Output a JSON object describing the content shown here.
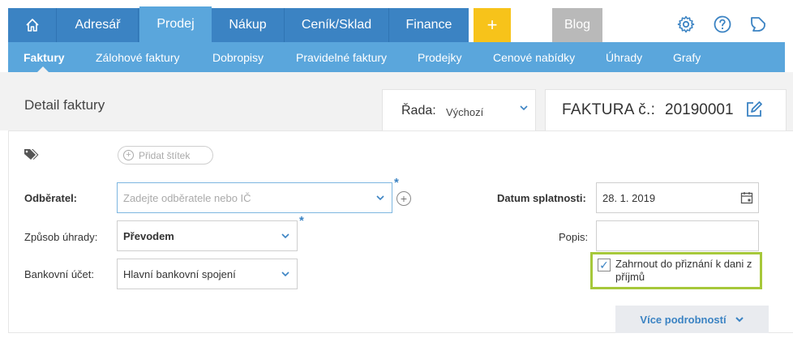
{
  "topnav": {
    "home_icon": "home-icon",
    "items": [
      {
        "label": "Adresář"
      },
      {
        "label": "Prodej",
        "active": true
      },
      {
        "label": "Nákup"
      },
      {
        "label": "Ceník/Sklad"
      },
      {
        "label": "Finance"
      }
    ],
    "plus_label": "+",
    "blog_label": "Blog",
    "icons": [
      "gear-icon",
      "help-icon",
      "feedback-icon"
    ],
    "colors": {
      "bar": "#3b83c3",
      "active": "#5aa6dc",
      "plus": "#f7c31a",
      "blog": "#b9b9b9"
    }
  },
  "subnav": {
    "items": [
      {
        "label": "Faktury",
        "active": true
      },
      {
        "label": "Zálohové faktury"
      },
      {
        "label": "Dobropisy"
      },
      {
        "label": "Pravidelné faktury"
      },
      {
        "label": "Prodejky"
      },
      {
        "label": "Cenové nabídky"
      },
      {
        "label": "Úhrady"
      },
      {
        "label": "Grafy"
      }
    ]
  },
  "header": {
    "title": "Detail faktury",
    "rada_label": "Řada:",
    "rada_value": "Výchozí",
    "faktura_label": "FAKTURA č.:",
    "faktura_number": "20190001"
  },
  "form": {
    "add_tag_label": "Přidat štítek",
    "odberatel_label": "Odběratel:",
    "odberatel_placeholder": "Zadejte odběratele nebo IČ",
    "zpusob_label": "Způsob úhrady:",
    "zpusob_value": "Převodem",
    "ucet_label": "Bankovní účet:",
    "ucet_value": "Hlavní bankovní spojení",
    "splatnost_label": "Datum splatnosti:",
    "splatnost_value": "28. 1. 2019",
    "popis_label": "Popis:",
    "popis_value": "",
    "checkbox_label": "Zahrnout do přiznání k dani z příjmů",
    "checkbox_checked": true,
    "required_mark": "*",
    "more_label": "Více podrobností"
  }
}
